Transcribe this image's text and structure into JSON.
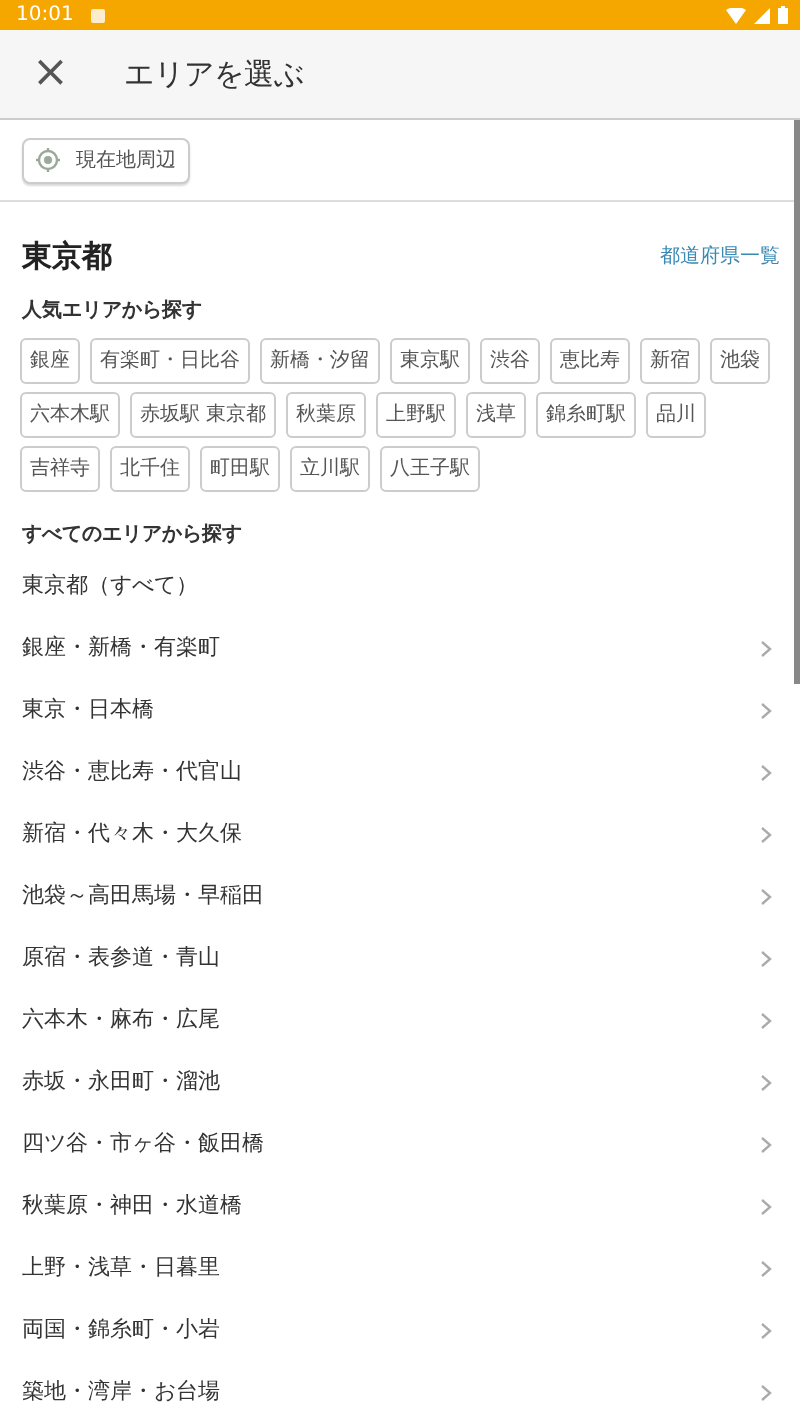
{
  "status_bar": {
    "time": "10:01"
  },
  "app_bar": {
    "close_icon": "×",
    "title": "エリアを選ぶ"
  },
  "location_button": {
    "label": "現在地周辺"
  },
  "prefecture": {
    "name": "東京都",
    "link": "都道府県一覧"
  },
  "popular": {
    "heading": "人気エリアから探す",
    "chips": [
      "銀座",
      "有楽町・日比谷",
      "新橋・汐留",
      "東京駅",
      "渋谷",
      "恵比寿",
      "新宿",
      "池袋",
      "六本木駅",
      "赤坂駅 東京都",
      "秋葉原",
      "上野駅",
      "浅草",
      "錦糸町駅",
      "品川",
      "吉祥寺",
      "北千住",
      "町田駅",
      "立川駅",
      "八王子駅"
    ]
  },
  "all_areas": {
    "heading": "すべてのエリアから探す",
    "items": [
      {
        "label": "東京都（すべて）",
        "chevron": false
      },
      {
        "label": "銀座・新橋・有楽町",
        "chevron": true
      },
      {
        "label": "東京・日本橋",
        "chevron": true
      },
      {
        "label": "渋谷・恵比寿・代官山",
        "chevron": true
      },
      {
        "label": "新宿・代々木・大久保",
        "chevron": true
      },
      {
        "label": "池袋～高田馬場・早稲田",
        "chevron": true
      },
      {
        "label": "原宿・表参道・青山",
        "chevron": true
      },
      {
        "label": "六本木・麻布・広尾",
        "chevron": true
      },
      {
        "label": "赤坂・永田町・溜池",
        "chevron": true
      },
      {
        "label": "四ツ谷・市ヶ谷・飯田橋",
        "chevron": true
      },
      {
        "label": "秋葉原・神田・水道橋",
        "chevron": true
      },
      {
        "label": "上野・浅草・日暮里",
        "chevron": true
      },
      {
        "label": "両国・錦糸町・小岩",
        "chevron": true
      },
      {
        "label": "築地・湾岸・お台場",
        "chevron": true
      }
    ]
  }
}
